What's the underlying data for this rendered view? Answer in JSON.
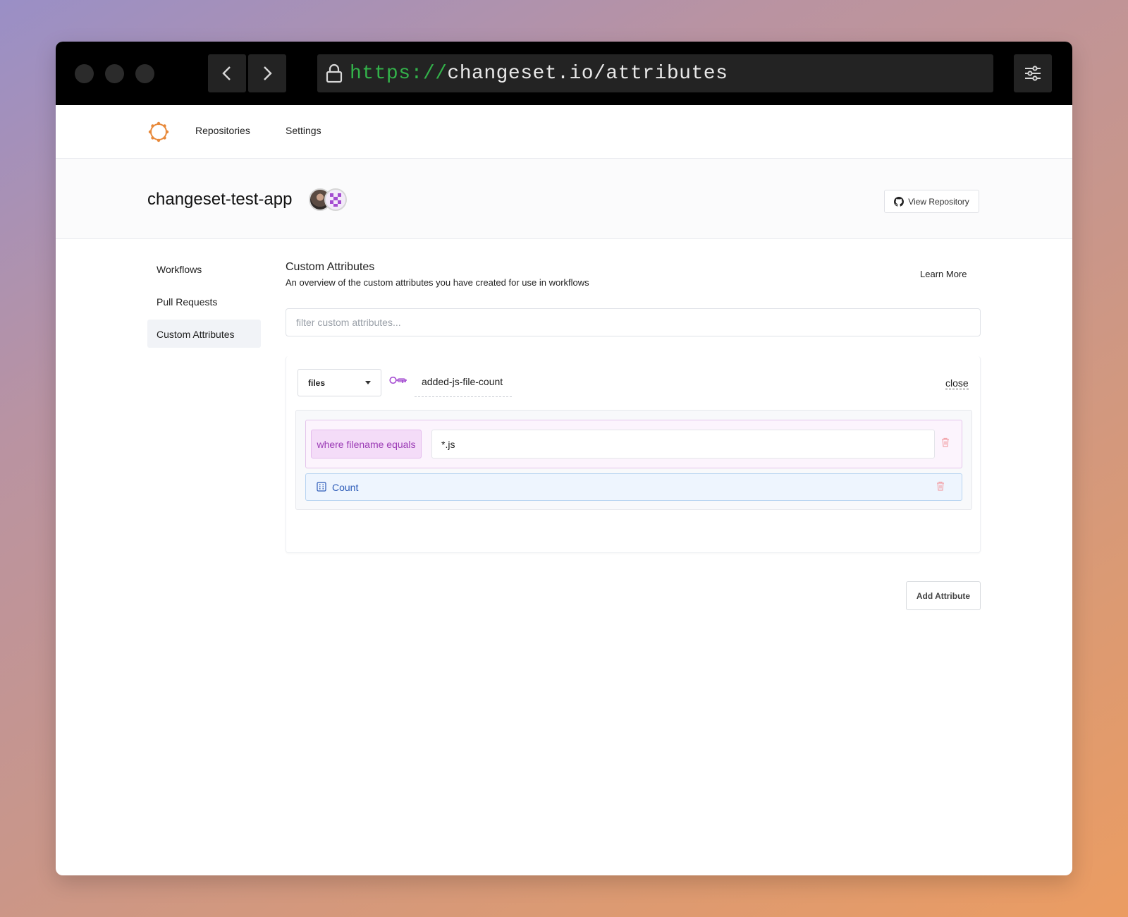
{
  "browser": {
    "url_scheme": "https://",
    "url_rest": "changeset.io/attributes"
  },
  "topnav": {
    "items": [
      {
        "label": "Repositories"
      },
      {
        "label": "Settings"
      }
    ]
  },
  "repo": {
    "title": "changeset-test-app",
    "view_button": "View Repository"
  },
  "sidebar": {
    "items": [
      {
        "label": "Workflows",
        "active": false
      },
      {
        "label": "Pull Requests",
        "active": false
      },
      {
        "label": "Custom Attributes",
        "active": true
      }
    ]
  },
  "main": {
    "title": "Custom Attributes",
    "subtitle": "An overview of the custom attributes you have created for use in workflows",
    "learn_more": "Learn More",
    "filter_placeholder": "filter custom attributes...",
    "add_button": "Add Attribute"
  },
  "attribute": {
    "source": "files",
    "name": "added-js-file-count",
    "close": "close",
    "filter": {
      "label": "where filename equals",
      "value": "*.js"
    },
    "aggregation": "Count"
  },
  "colors": {
    "accent_purple": "#9b3bb5",
    "accent_blue": "#2c5bb8",
    "logo_orange": "#e8893a",
    "url_green": "#33b24a"
  }
}
